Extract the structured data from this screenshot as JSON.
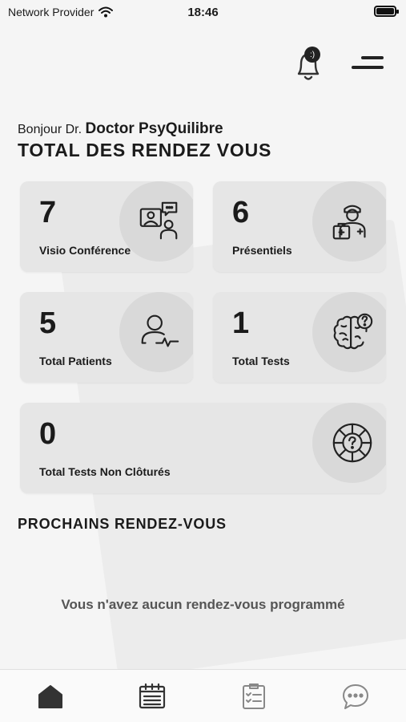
{
  "status_bar": {
    "carrier": "Network Provider",
    "time": "18:46"
  },
  "header": {
    "notification_badge": ":)"
  },
  "greeting": {
    "prefix": "Bonjour Dr.",
    "name": "Doctor PsyQuilibre"
  },
  "sections": {
    "total_title": "TOTAL DES RENDEZ VOUS",
    "next_title": "PROCHAINS RENDEZ-VOUS"
  },
  "cards": [
    {
      "value": "7",
      "label": "Visio Conférence",
      "icon": "video-conference-icon"
    },
    {
      "value": "6",
      "label": "Présentiels",
      "icon": "doctor-briefcase-icon"
    },
    {
      "value": "5",
      "label": "Total Patients",
      "icon": "patient-pulse-icon"
    },
    {
      "value": "1",
      "label": "Total Tests",
      "icon": "brain-question-icon"
    },
    {
      "value": "0",
      "label": "Total Tests Non Clôturés",
      "icon": "wheel-question-icon"
    }
  ],
  "empty_message": "Vous n'avez aucun rendez-vous programmé",
  "tabs": [
    {
      "icon": "home-icon",
      "active": true
    },
    {
      "icon": "calendar-list-icon",
      "active": false
    },
    {
      "icon": "checklist-icon",
      "active": false
    },
    {
      "icon": "chat-bubble-icon",
      "active": false
    }
  ]
}
